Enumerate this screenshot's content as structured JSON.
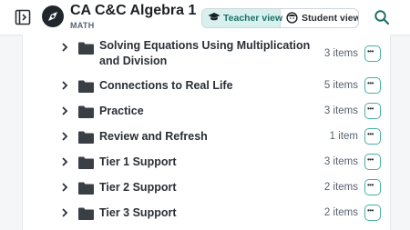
{
  "course": {
    "title": "CA C&C Algebra 1",
    "subject": "MATH"
  },
  "view_switch": {
    "teacher_label": "Teacher view",
    "student_label": "Student view",
    "selected": "Teacher view"
  },
  "icons": {
    "sidebar": "sidebar-toggle-icon",
    "logo": "compass-logo-icon",
    "teacher": "graduation-cap-icon",
    "student": "student-face-icon",
    "search": "search-icon",
    "expand": "chevron-right-icon",
    "folder": "folder-icon",
    "more": "more-options-icon"
  },
  "colors": {
    "accent": "#47aea3",
    "selected_bg": "#d8f1ee"
  },
  "folders": [
    {
      "label": "Solving Equations Using Multiplication and Division",
      "count": "3 items"
    },
    {
      "label": "Connections to Real Life",
      "count": "5 items"
    },
    {
      "label": "Practice",
      "count": "3 items"
    },
    {
      "label": "Review and Refresh",
      "count": "1 item"
    },
    {
      "label": "Tier 1 Support",
      "count": "3 items"
    },
    {
      "label": "Tier 2 Support",
      "count": "2 items"
    },
    {
      "label": "Tier 3 Support",
      "count": "2 items"
    }
  ]
}
